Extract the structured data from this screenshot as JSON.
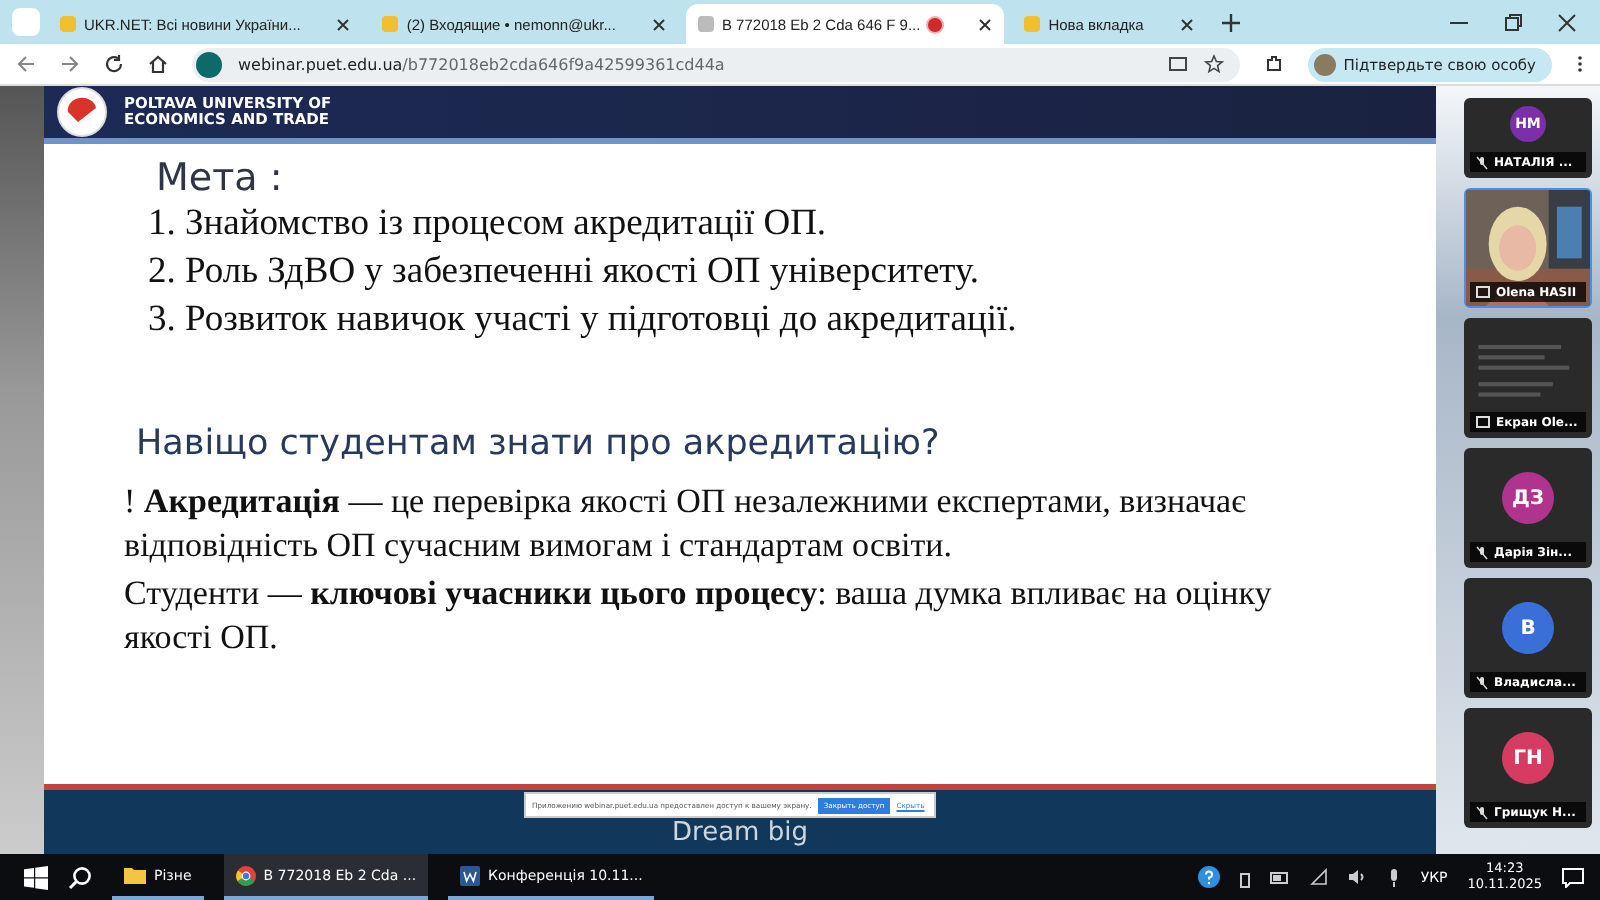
{
  "browser": {
    "tabs": [
      {
        "title": "UKR.NET: Всі новини України...",
        "selected": false,
        "recording": false
      },
      {
        "title": "(2) Входящие • nemonn@ukr...",
        "selected": false,
        "recording": false
      },
      {
        "title": "B 772018 Eb 2 Cda 646 F 9...",
        "selected": true,
        "recording": true
      },
      {
        "title": "Нова вкладка",
        "selected": false,
        "recording": false
      }
    ],
    "address_domain": "webinar.puet.edu.ua",
    "address_path": "/b772018eb2cda646f9a42599361cd44a",
    "profile_button": "Підтвердьте свою особу"
  },
  "slide": {
    "university": [
      "POLTAVA UNIVERSITY OF",
      "ECONOMICS AND TRADE"
    ],
    "goal_title": "Мета :",
    "goals": [
      "1. Знайомство із процесом акредитації ОП.",
      "2. Роль ЗдВО у забезпеченні якості ОП університету.",
      "3. Розвиток навичок участі у підготовці до акредитації."
    ],
    "question": "Навіщо студентам знати про акредитацію?",
    "paragraphs": [
      "! **Акредитація** — це перевірка якості ОП незалежними експертами, визначає відповідність ОП сучасним вимогам і стандартам освіти.",
      "Студенти — **ключові учасники цього процесу**: ваша думка впливає на оцінку якості ОП."
    ],
    "footer": "Dream big"
  },
  "share_notice": {
    "text": "Приложению webinar.puet.edu.ua предоставлен доступ к вашему экрану.",
    "stop_button": "Закрыть доступ",
    "hide_link": "Скрыть"
  },
  "participants": [
    {
      "kind": "avatar",
      "initials": "НМ",
      "name": "НАТАЛІЯ ...",
      "color": "#7b2fa8",
      "selected": false
    },
    {
      "kind": "video",
      "name": "Olena HASII",
      "selected": true
    },
    {
      "kind": "screen",
      "name": "Екран Оle...",
      "selected": false
    },
    {
      "kind": "avatar",
      "initials": "ДЗ",
      "name": "Дарія Зін...",
      "color": "#b0338e",
      "selected": false
    },
    {
      "kind": "avatar",
      "initials": "В",
      "name": "Владисла...",
      "color": "#3b6fd8",
      "selected": false
    },
    {
      "kind": "avatar",
      "initials": "ГН",
      "name": "Грищук Н...",
      "color": "#d63b62",
      "selected": false
    }
  ],
  "taskbar": {
    "items": [
      {
        "kind": "folder",
        "label": "Різне",
        "selected": false
      },
      {
        "kind": "chrome",
        "label": "B 772018 Eb 2 Cda ...",
        "selected": true
      },
      {
        "kind": "word",
        "label": "Конференція 10.11...",
        "selected": false
      }
    ],
    "language": "УКР",
    "time": "14:23",
    "date": "10.11.2025"
  }
}
